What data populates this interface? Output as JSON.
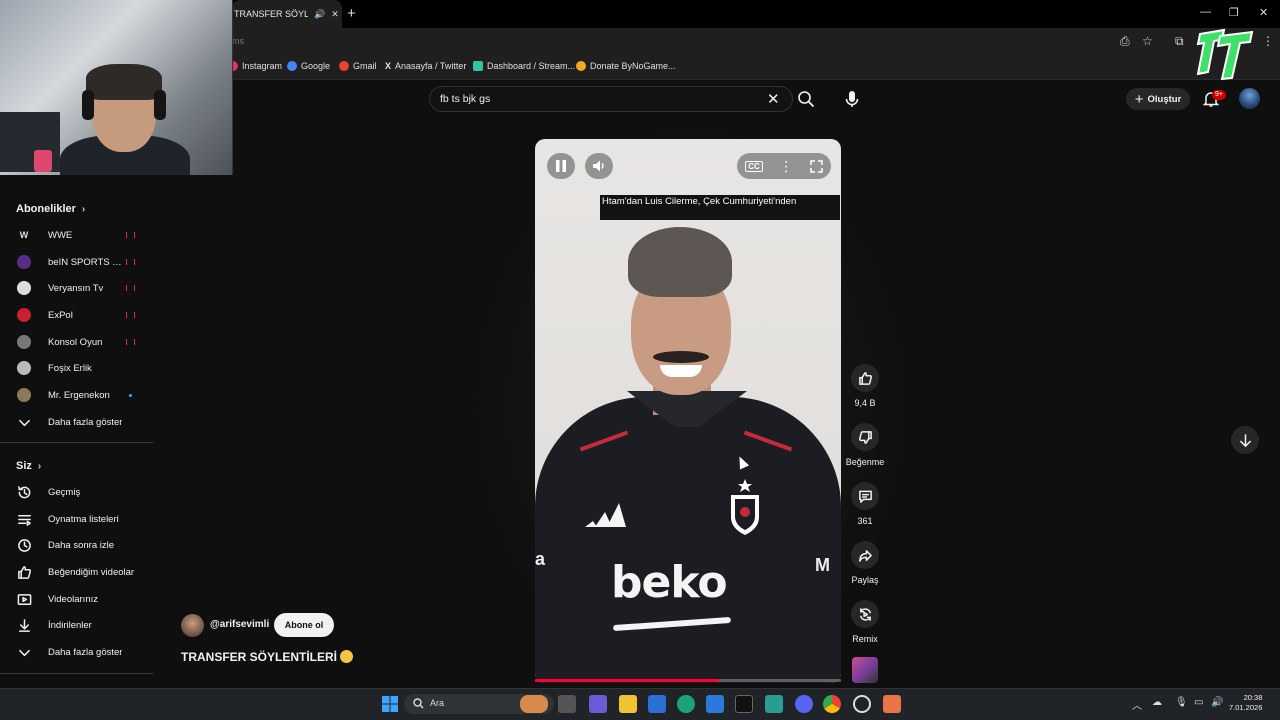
{
  "browser": {
    "tab_title": "TRANSFER SÖYLENTİ...",
    "omnibox_fragment": "ms",
    "bookmarks": [
      {
        "label": "Instagram",
        "icon": "instagram-icon",
        "color": "#e1306c"
      },
      {
        "label": "Google",
        "icon": "google-icon",
        "color": "#4285f4"
      },
      {
        "label": "Gmail",
        "icon": "gmail-icon",
        "color": "#ea4335"
      },
      {
        "label": "Anasayfa / Twitter",
        "icon": "x-icon",
        "color": "#ffffff"
      },
      {
        "label": "Dashboard / Stream...",
        "icon": "streamlabs-icon",
        "color": "#31c3a2"
      },
      {
        "label": "Donate ByNoGame...",
        "icon": "bynogame-icon",
        "color": "#f5a623"
      }
    ]
  },
  "search": {
    "query": "fb ts bjk gs"
  },
  "header": {
    "create_label": "Oluştur",
    "notif_badge": "9+"
  },
  "sidebar": {
    "subscriptions_title": "Abonelikler",
    "subscriptions": [
      {
        "label": "WWE",
        "status": "live"
      },
      {
        "label": "beIN SPORTS Tü...",
        "status": "live"
      },
      {
        "label": "Veryansın Tv",
        "status": "live"
      },
      {
        "label": "ExPol",
        "status": "live"
      },
      {
        "label": "Konsol Oyun",
        "status": "live"
      },
      {
        "label": "Foşix Erlik",
        "status": ""
      },
      {
        "label": "Mr. Ergenekon",
        "status": "new"
      }
    ],
    "subs_more": "Daha fazla göster",
    "you_title": "Siz",
    "you_items": [
      {
        "label": "Geçmiş",
        "icon": "history-icon"
      },
      {
        "label": "Oynatma listeleri",
        "icon": "playlist-icon"
      },
      {
        "label": "Daha sonra izle",
        "icon": "watch-later-icon"
      },
      {
        "label": "Beğendiğim videolar",
        "icon": "like-icon"
      },
      {
        "label": "Videolarınız",
        "icon": "your-videos-icon"
      },
      {
        "label": "İndirilenler",
        "icon": "download-icon"
      }
    ],
    "you_more": "Daha fazla göster"
  },
  "player": {
    "caption_text": "Htam'dan Luis Cilerme, Çek Cumhuriyeti'nden",
    "overlay_text": "beko",
    "progress": 0.6
  },
  "actions": {
    "like_count": "9,4 B",
    "dislike_label": "Beğenme",
    "comment_count": "361",
    "share_label": "Paylaş",
    "remix_label": "Remix"
  },
  "channel": {
    "handle": "@arifsevimli",
    "subscribe_label": "Abone ol"
  },
  "video": {
    "title": "TRANSFER SÖYLENTİLERİ"
  },
  "taskbar": {
    "search_placeholder": "Ara",
    "time": "20:38",
    "date": "7.01.2026"
  }
}
